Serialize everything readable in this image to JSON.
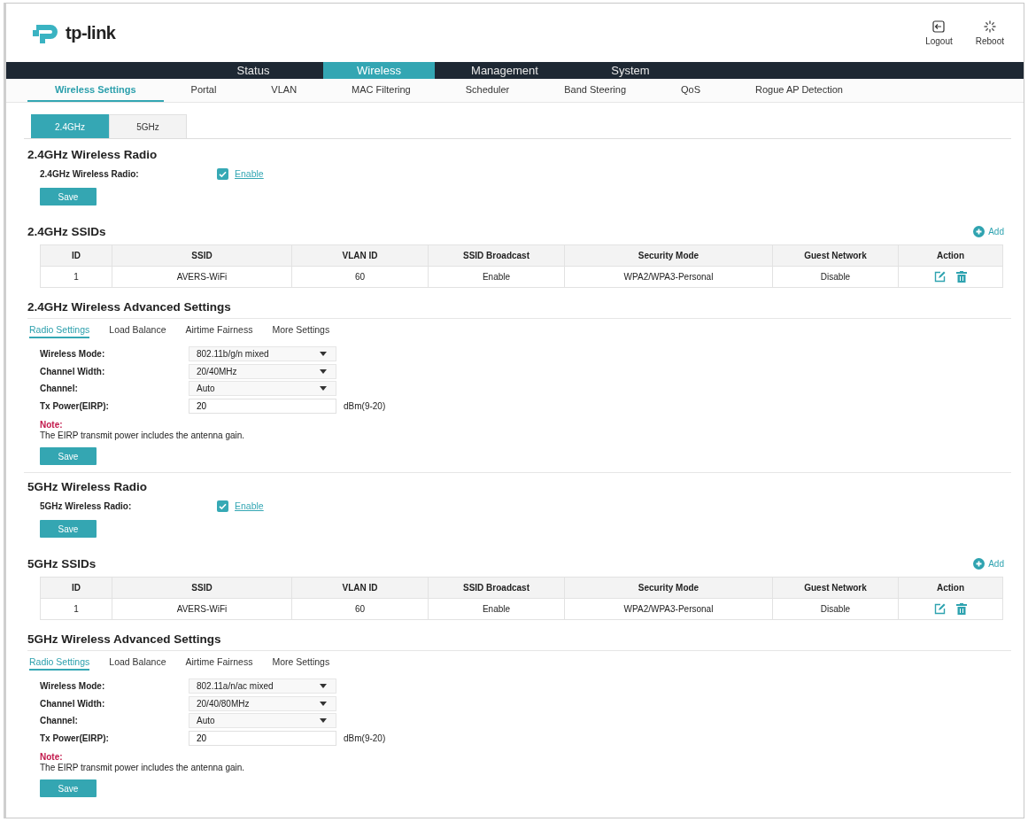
{
  "header": {
    "logo": "tp-link",
    "actions": [
      {
        "kind": "logout",
        "label": "Logout"
      },
      {
        "kind": "reboot",
        "label": "Reboot"
      }
    ]
  },
  "nav": [
    {
      "label": "Status",
      "selected": false
    },
    {
      "label": "Wireless",
      "selected": true
    },
    {
      "label": "Management",
      "selected": false
    },
    {
      "label": "System",
      "selected": false
    }
  ],
  "subtabs": [
    {
      "label": "Wireless Settings",
      "selected": true
    },
    {
      "label": "Portal",
      "selected": false
    },
    {
      "label": "VLAN",
      "selected": false
    },
    {
      "label": "MAC Filtering",
      "selected": false
    },
    {
      "label": "Scheduler",
      "selected": false
    },
    {
      "label": "Band Steering",
      "selected": false
    },
    {
      "label": "QoS",
      "selected": false
    },
    {
      "label": "Rogue AP Detection",
      "selected": false
    }
  ],
  "band_tabs": [
    {
      "label": "2.4GHz",
      "selected": true
    },
    {
      "label": "5GHz",
      "selected": false
    }
  ],
  "sections": [
    {
      "kind": "radio",
      "title": "2.4GHz Wireless Radio",
      "label": "2.4GHz Wireless Radio:",
      "checked": true,
      "option": "Enable",
      "button": "Save"
    },
    {
      "kind": "ssids",
      "title": "2.4GHz SSIDs",
      "add": "Add",
      "columns": [
        "ID",
        "SSID",
        "VLAN ID",
        "SSID Broadcast",
        "Security Mode",
        "Guest Network",
        "Action"
      ],
      "rows": [
        [
          "1",
          "AVERS-WiFi",
          "60",
          "Enable",
          "WPA2/WPA3-Personal",
          "Disable"
        ]
      ]
    },
    {
      "kind": "advanced",
      "title": "2.4GHz Wireless Advanced Settings",
      "tabs": [
        {
          "label": "Radio Settings",
          "selected": true
        },
        {
          "label": "Load Balance",
          "selected": false
        },
        {
          "label": "Airtime Fairness",
          "selected": false
        },
        {
          "label": "More Settings",
          "selected": false
        }
      ],
      "fields": [
        {
          "kind": "select",
          "label": "Wireless Mode:",
          "value": "802.11b/g/n mixed"
        },
        {
          "kind": "select",
          "label": "Channel Width:",
          "value": "20/40MHz"
        },
        {
          "kind": "select",
          "label": "Channel:",
          "value": "Auto"
        },
        {
          "kind": "input",
          "label": "Tx Power(EIRP):",
          "value": "20",
          "unit": "dBm(9-20)"
        }
      ],
      "note_title": "Note:",
      "note": "The EIRP transmit power includes the antenna gain.",
      "button": "Save"
    },
    {
      "kind": "radio",
      "title": "5GHz Wireless Radio",
      "label": "5GHz Wireless Radio:",
      "checked": true,
      "option": "Enable",
      "button": "Save"
    },
    {
      "kind": "ssids",
      "title": "5GHz SSIDs",
      "add": "Add",
      "columns": [
        "ID",
        "SSID",
        "VLAN ID",
        "SSID Broadcast",
        "Security Mode",
        "Guest Network",
        "Action"
      ],
      "rows": [
        [
          "1",
          "AVERS-WiFi",
          "60",
          "Enable",
          "WPA2/WPA3-Personal",
          "Disable"
        ]
      ]
    },
    {
      "kind": "advanced",
      "title": "5GHz Wireless Advanced Settings",
      "tabs": [
        {
          "label": "Radio Settings",
          "selected": true
        },
        {
          "label": "Load Balance",
          "selected": false
        },
        {
          "label": "Airtime Fairness",
          "selected": false
        },
        {
          "label": "More Settings",
          "selected": false
        }
      ],
      "fields": [
        {
          "kind": "select",
          "label": "Wireless Mode:",
          "value": "802.11a/n/ac mixed"
        },
        {
          "kind": "select",
          "label": "Channel Width:",
          "value": "20/40/80MHz"
        },
        {
          "kind": "select",
          "label": "Channel:",
          "value": "Auto"
        },
        {
          "kind": "input",
          "label": "Tx Power(EIRP):",
          "value": "20",
          "unit": "dBm(9-20)"
        }
      ],
      "note_title": "Note:",
      "note": "The EIRP transmit power includes the antenna gain.",
      "button": "Save"
    }
  ]
}
